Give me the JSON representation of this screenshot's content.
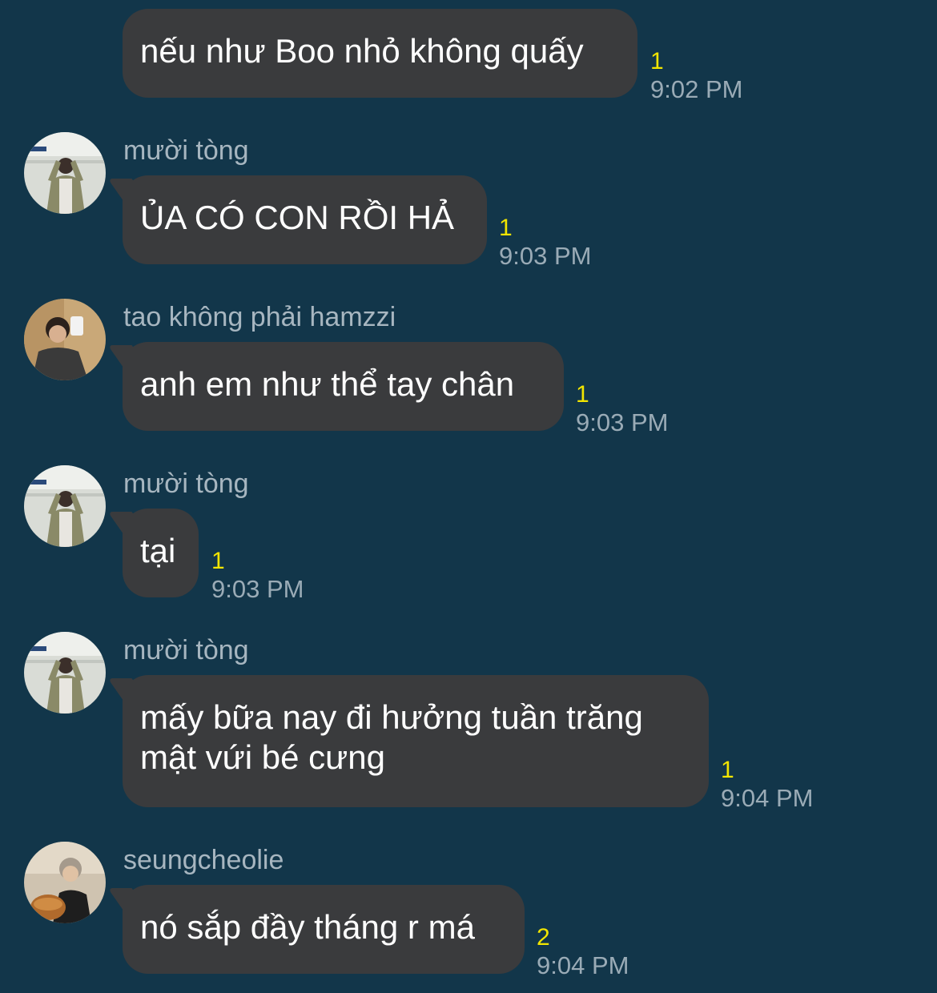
{
  "messages": [
    {
      "sender": "",
      "text": "nếu như Boo nhỏ không quấy",
      "unread": "1",
      "time": "9:02 PM",
      "avatar": "none"
    },
    {
      "sender": "mười tòng",
      "text": "ỦA CÓ CON RỒI HẢ",
      "unread": "1",
      "time": "9:03 PM",
      "avatar": "photo-person-subway"
    },
    {
      "sender": "tao không phải hamzzi",
      "text": "anh em như thể tay chân",
      "unread": "1",
      "time": "9:03 PM",
      "avatar": "photo-person-selfie"
    },
    {
      "sender": "mười tòng",
      "text": "tại",
      "unread": "1",
      "time": "9:03 PM",
      "avatar": "photo-person-subway"
    },
    {
      "sender": "mười tòng",
      "text_line1": "mấy bữa nay đi hưởng tuần trăng",
      "text_line2": "mật vứi bé cưng",
      "unread": "1",
      "time": "9:04 PM",
      "avatar": "photo-person-subway"
    },
    {
      "sender": "seungcheolie",
      "text": "nó sắp đầy tháng r má",
      "unread": "2",
      "time": "9:04 PM",
      "avatar": "photo-person-food"
    }
  ],
  "colors": {
    "background": "#12364a",
    "bubble": "#3a3b3d",
    "unread": "#f2e500",
    "time": "#9aabb6",
    "sender": "#a7b6c0"
  }
}
